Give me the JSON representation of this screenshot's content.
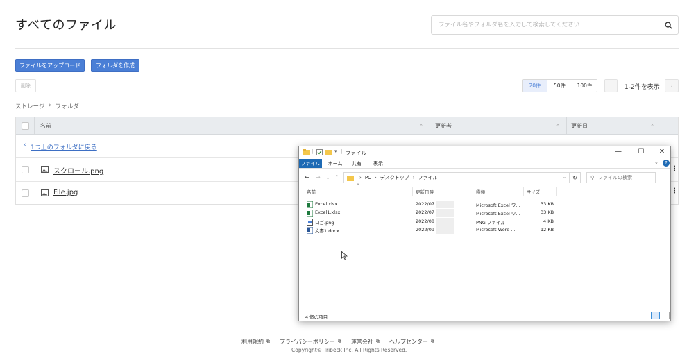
{
  "header": {
    "title": "すべてのファイル",
    "search_placeholder": "ファイル名やフォルダ名を入力して検索してください"
  },
  "toolbar": {
    "upload_label": "ファイルをアップロード",
    "create_folder_label": "フォルダを作成",
    "delete_label": "削除"
  },
  "pagination": {
    "sizes": [
      "20件",
      "50件",
      "100件"
    ],
    "selected": "20件",
    "info": "1-2件を表示"
  },
  "breadcrumb": {
    "root": "ストレージ",
    "separator": "›",
    "current": "フォルダ"
  },
  "table": {
    "columns": [
      "名前",
      "更新者",
      "更新日"
    ],
    "back_link": "1つ上のフォルダに戻る",
    "rows": [
      {
        "name": "スクロール.png"
      },
      {
        "name": "File.jpg"
      }
    ]
  },
  "explorer": {
    "title": "ファイル",
    "ribbon_tabs": [
      "ファイル",
      "ホーム",
      "共有",
      "表示"
    ],
    "path": [
      "PC",
      "デスクトップ",
      "ファイル"
    ],
    "search_placeholder": "ファイルの検索",
    "columns": [
      "名前",
      "更新日時",
      "種類",
      "サイズ"
    ],
    "files": [
      {
        "name": "Excel.xlsx",
        "date": "2022/07",
        "type": "Microsoft Excel ワ...",
        "size": "33 KB",
        "icon": "excel-icon"
      },
      {
        "name": "Excel1.xlsx",
        "date": "2022/07",
        "type": "Microsoft Excel ワ...",
        "size": "33 KB",
        "icon": "excel-icon"
      },
      {
        "name": "ロゴ.png",
        "date": "2022/08",
        "type": "PNG ファイル",
        "size": "4 KB",
        "icon": "image-icon"
      },
      {
        "name": "文書1.docx",
        "date": "2022/09",
        "type": "Microsoft Word ...",
        "size": "12 KB",
        "icon": "word-icon"
      }
    ],
    "status": "4 個の項目"
  },
  "footer": {
    "links": [
      "利用規約",
      "プライバシーポリシー",
      "運営会社",
      "ヘルプセンター"
    ],
    "copyright": "Copyright© Tribeck Inc. All Rights Reserved."
  },
  "colors": {
    "accent": "#4a7fd6",
    "link": "#3d6fc4",
    "ribbon_file": "#1e6ab4"
  }
}
